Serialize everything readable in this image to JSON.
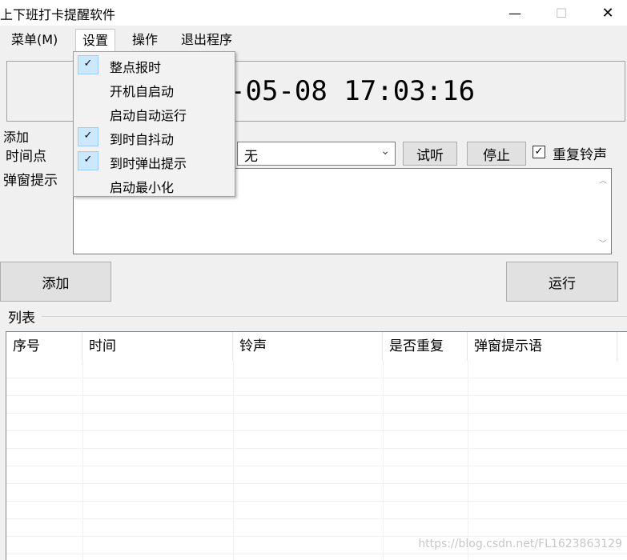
{
  "window": {
    "title": "上下班打卡提醒软件",
    "min_glyph": "—",
    "max_glyph": "☐",
    "close_glyph": "✕"
  },
  "menubar": {
    "items": [
      "菜单(M)",
      "设置",
      "操作",
      "退出程序"
    ]
  },
  "settings_menu": {
    "items": [
      {
        "label": "整点报时",
        "checked": true
      },
      {
        "label": "开机自启动",
        "checked": false
      },
      {
        "label": "启动自动运行",
        "checked": false
      },
      {
        "label": "到时自抖动",
        "checked": true
      },
      {
        "label": "到时弹出提示",
        "checked": true
      },
      {
        "label": "启动最小化",
        "checked": false
      }
    ],
    "check_glyph": "✓"
  },
  "clock": {
    "display": "-05-08  17:03:16"
  },
  "add_group": {
    "title": "添加",
    "time_label": "时间点",
    "popup_label": "弹窗提示",
    "ringtone_value": "无",
    "try_button": "试听",
    "stop_button": "停止",
    "repeat_checked": true,
    "repeat_label": "重复铃声",
    "check_glyph": "✓",
    "popup_text": ""
  },
  "buttons": {
    "add": "添加",
    "run": "运行"
  },
  "list": {
    "title": "列表",
    "columns": [
      "序号",
      "时间",
      "铃声",
      "是否重复",
      "弹窗提示语"
    ],
    "rows": []
  },
  "watermark": "https://blog.csdn.net/FL1623863129"
}
